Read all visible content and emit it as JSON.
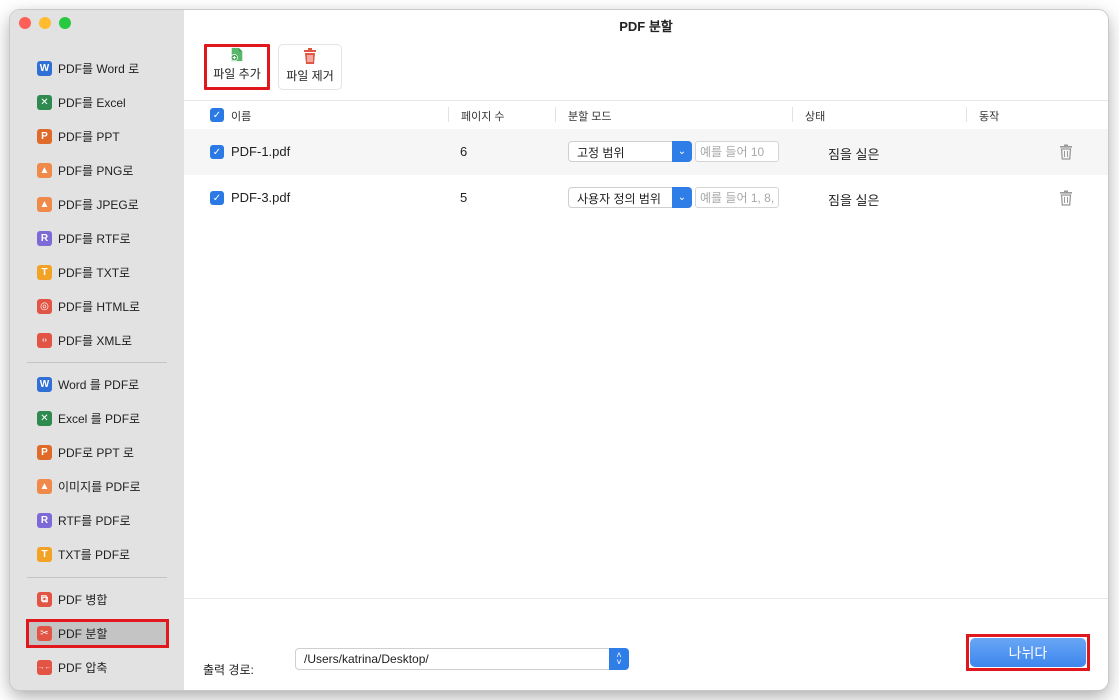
{
  "window": {
    "title": "PDF 분할"
  },
  "sidebar": {
    "group1": [
      {
        "label": "PDF를 Word 로",
        "icon": "word-icon",
        "glyph": "W",
        "color": "#2f6fd6"
      },
      {
        "label": "PDF를 Excel",
        "icon": "excel-icon",
        "glyph": "✕",
        "color": "#2e8a4f"
      },
      {
        "label": "PDF를 PPT",
        "icon": "ppt-icon",
        "glyph": "P",
        "color": "#e06a2a"
      },
      {
        "label": "PDF를 PNG로",
        "icon": "image-icon",
        "glyph": "▲",
        "color": "#f08a4b"
      },
      {
        "label": "PDF를 JPEG로",
        "icon": "image-icon",
        "glyph": "▲",
        "color": "#f08a4b"
      },
      {
        "label": "PDF를 RTF로",
        "icon": "rtf-icon",
        "glyph": "R",
        "color": "#7d6ad6"
      },
      {
        "label": "PDF를 TXT로",
        "icon": "txt-icon",
        "glyph": "T",
        "color": "#f2a325"
      },
      {
        "label": "PDF를 HTML로",
        "icon": "html-icon",
        "glyph": "◎",
        "color": "#e25545"
      },
      {
        "label": "PDF를 XML로",
        "icon": "xml-icon",
        "glyph": "‹›",
        "color": "#e25545"
      }
    ],
    "group2": [
      {
        "label": "Word 를 PDF로",
        "icon": "word-icon",
        "glyph": "W",
        "color": "#2f6fd6"
      },
      {
        "label": "Excel 를 PDF로",
        "icon": "excel-icon",
        "glyph": "✕",
        "color": "#2e8a4f"
      },
      {
        "label": "PDF로 PPT 로",
        "icon": "ppt-icon",
        "glyph": "P",
        "color": "#e06a2a"
      },
      {
        "label": "이미지를 PDF로",
        "icon": "image-icon",
        "glyph": "▲",
        "color": "#f08a4b"
      },
      {
        "label": "RTF를 PDF로",
        "icon": "rtf-icon",
        "glyph": "R",
        "color": "#7d6ad6"
      },
      {
        "label": "TXT를 PDF로",
        "icon": "txt-icon",
        "glyph": "T",
        "color": "#f2a325"
      }
    ],
    "group3": [
      {
        "label": "PDF 병합",
        "icon": "merge-icon",
        "glyph": "⧉",
        "color": "#e25545"
      },
      {
        "label": "PDF 분할",
        "icon": "scissors-icon",
        "glyph": "✂",
        "color": "#e25545"
      },
      {
        "label": "PDF 압축",
        "icon": "compress-icon",
        "glyph": "→←",
        "color": "#e25545"
      }
    ]
  },
  "toolbar": {
    "add_label": "파일 추가",
    "remove_label": "파일 제거"
  },
  "table": {
    "headers": {
      "name": "이름",
      "pages": "페이지 수",
      "mode": "분할 모드",
      "status": "상태",
      "action": "동작"
    },
    "rows": [
      {
        "name": "PDF-1.pdf",
        "pages": "6",
        "mode": "고정 범위",
        "placeholder": "예를 들어 10",
        "status": "짐을 실은"
      },
      {
        "name": "PDF-3.pdf",
        "pages": "5",
        "mode": "사용자 정의 범위",
        "placeholder": "예를 들어 1, 8,",
        "status": "짐을 실은"
      }
    ]
  },
  "footer": {
    "output_label": "출력 경로:",
    "output_path": "/Users/katrina/Desktop/",
    "split_label": "나뉘다"
  }
}
